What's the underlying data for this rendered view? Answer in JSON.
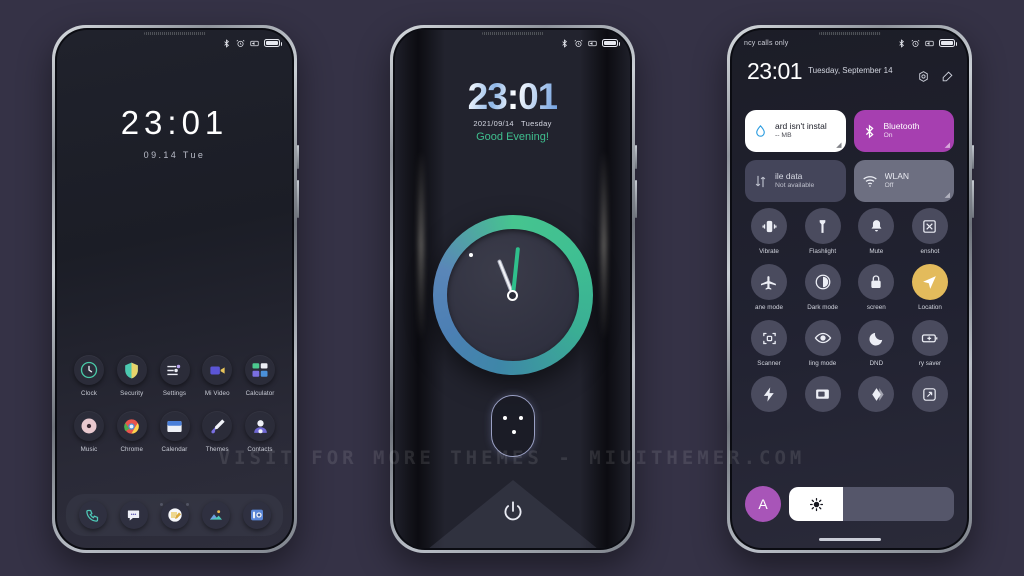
{
  "background_color": "#353246",
  "watermark": "VISIT FOR MORE THEMES - MIUITHEMER.COM",
  "phone1": {
    "name": "lock-home-screen",
    "status": {
      "bluetooth": "bluetooth-icon",
      "alarm": "alarm-icon",
      "dnd": "dnd-icon",
      "battery": "battery-icon"
    },
    "clock": "23:01",
    "date": "09.14  Tue",
    "apps": [
      [
        {
          "label": "Clock",
          "icon": "clock-icon"
        },
        {
          "label": "Security",
          "icon": "shield-icon"
        },
        {
          "label": "Settings",
          "icon": "sliders-icon"
        },
        {
          "label": "Mi Video",
          "icon": "video-camera-icon"
        },
        {
          "label": "Calculator",
          "icon": "calculator-grid-icon"
        }
      ],
      [
        {
          "label": "Music",
          "icon": "music-disc-icon"
        },
        {
          "label": "Chrome",
          "icon": "chrome-icon"
        },
        {
          "label": "Calendar",
          "icon": "calendar-icon"
        },
        {
          "label": "Themes",
          "icon": "paint-brush-icon"
        },
        {
          "label": "Contacts",
          "icon": "contacts-person-icon"
        }
      ]
    ],
    "page_dots": {
      "count": 3,
      "active_index": 1
    },
    "dock": [
      {
        "name": "phone-icon"
      },
      {
        "name": "messages-icon"
      },
      {
        "name": "notes-icon"
      },
      {
        "name": "gallery-icon"
      },
      {
        "name": "camera-icon"
      }
    ]
  },
  "phone2": {
    "name": "clock-widget-lock-screen",
    "time": "23:01",
    "date": "2021/09/14",
    "weekday": "Tuesday",
    "greeting": "Good Evening!",
    "greeting_color": "#3fbf8f",
    "analog_clock": {
      "hour_angle_deg": -22,
      "minute_angle_deg": 6,
      "ring_start": "#46c48f",
      "ring_end": "#4c7fb4"
    },
    "face_unlock_icon": "face-unlock-icon",
    "power_icon": "power-icon"
  },
  "phone3": {
    "name": "control-center",
    "carrier": "ncy calls only",
    "time": "23:01",
    "date": "Tuesday, September 14",
    "header_actions": [
      {
        "name": "settings-gear-icon"
      },
      {
        "name": "edit-icon"
      }
    ],
    "big_tiles": [
      {
        "title": "ard isn't instal",
        "sub": "-- MB",
        "icon": "sd-card-drop-icon",
        "style": "white"
      },
      {
        "title": "Bluetooth",
        "sub": "On",
        "icon": "bluetooth-icon",
        "style": "purple"
      },
      {
        "title": "ile data",
        "sub": "Not available",
        "icon": "mobile-data-icon",
        "style": "dark"
      },
      {
        "title": "WLAN",
        "sub": "Off",
        "icon": "wifi-icon",
        "style": "dark2"
      }
    ],
    "toggles": [
      [
        {
          "label": "Vibrate",
          "icon": "vibrate-icon",
          "active": false
        },
        {
          "label": "Flashlight",
          "icon": "flashlight-icon",
          "active": false
        },
        {
          "label": "Mute",
          "icon": "bell-icon",
          "active": false
        },
        {
          "label": "enshot",
          "icon": "screenshot-icon",
          "active": false
        }
      ],
      [
        {
          "label": "ane mode",
          "icon": "airplane-icon",
          "active": false
        },
        {
          "label": "Dark mode",
          "icon": "contrast-icon",
          "active": false
        },
        {
          "label": "screen",
          "icon": "lock-icon",
          "active": false
        },
        {
          "label": "Location",
          "icon": "location-arrow-icon",
          "active": true
        }
      ],
      [
        {
          "label": "Scanner",
          "icon": "scanner-icon",
          "active": false
        },
        {
          "label": "ling mode",
          "icon": "eye-icon",
          "active": false
        },
        {
          "label": "DND",
          "icon": "moon-icon",
          "active": false
        },
        {
          "label": "ry saver",
          "icon": "battery-saver-icon",
          "active": false
        }
      ],
      [
        {
          "label": "",
          "icon": "lightning-icon",
          "active": false
        },
        {
          "label": "",
          "icon": "cast-icon",
          "active": false
        },
        {
          "label": "",
          "icon": "layers-icon",
          "active": false
        },
        {
          "label": "",
          "icon": "rotate-icon",
          "active": false
        }
      ]
    ],
    "brightness": {
      "auto_label": "A",
      "icon": "brightness-sun-icon",
      "fill_percent": 33
    }
  }
}
